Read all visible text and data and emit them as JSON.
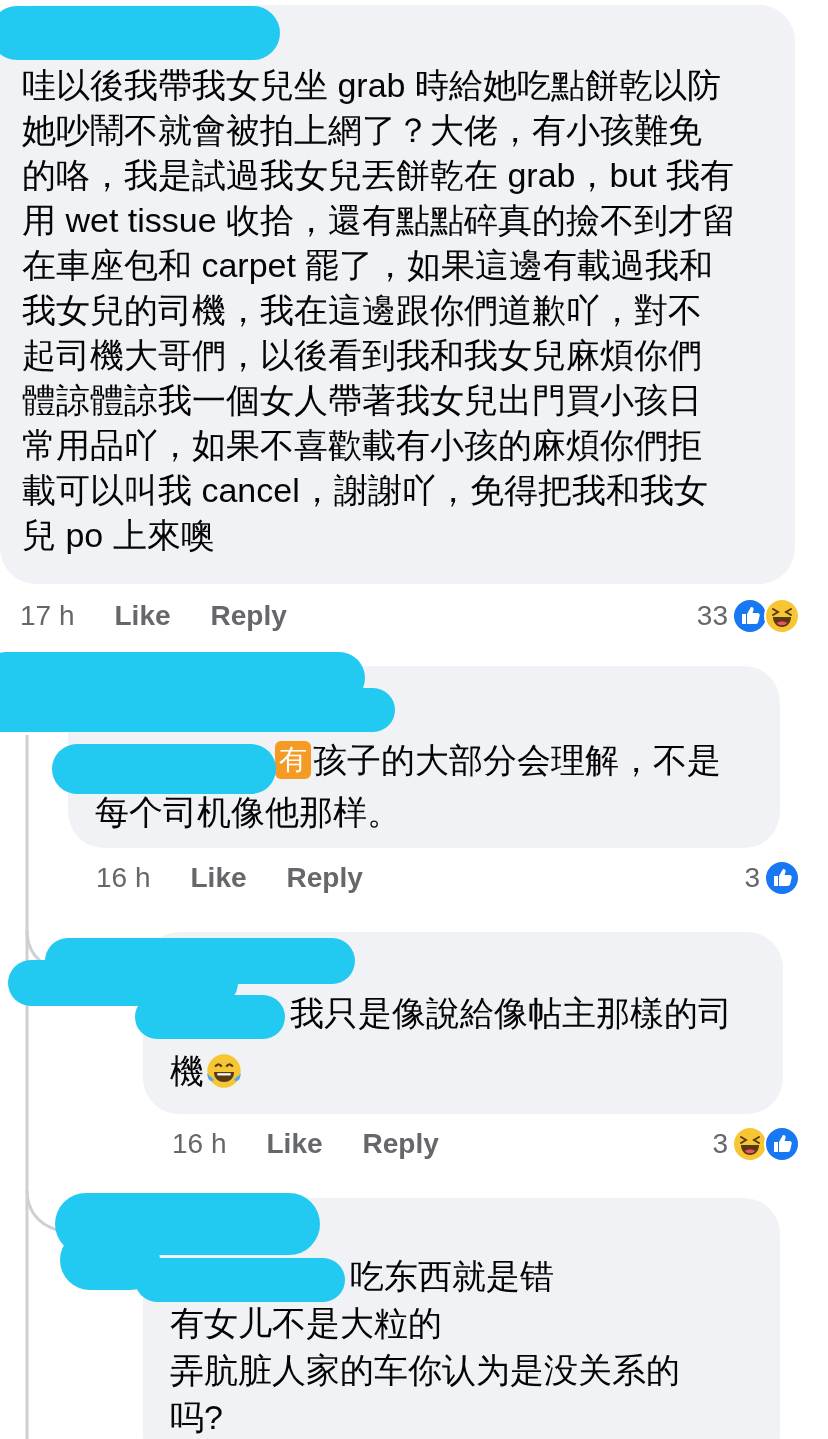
{
  "comments": [
    {
      "lines": [
        "哇以後我帶我女兒坐 grab 時給她吃點餅乾以防",
        "她吵鬧不就會被拍上網了？大佬，有小孩難免",
        "的咯，我是試過我女兒丟餅乾在 grab，but 我有",
        "用 wet tissue 收拾，還有點點碎真的撿不到才留",
        "在車座包和 carpet 罷了，如果這邊有載過我和",
        "我女兒的司機，我在這邊跟你們道歉吖，對不",
        "起司機大哥們，以後看到我和我女兒麻煩你們",
        "體諒體諒我一個女人帶著我女兒出門買小孩日",
        "常用品吖，如果不喜歡載有小孩的麻煩你們拒",
        "載可以叫我 cancel，謝謝吖，免得把我和我女",
        "兒 po 上來噢"
      ],
      "time": "17 h",
      "like": "Like",
      "reply": "Reply",
      "reaction_count": "33",
      "reactions": [
        {
          "kind": "like"
        },
        {
          "kind": "haha"
        }
      ]
    },
    {
      "lead_badge": "有",
      "lines": [
        "孩子的大部分会理解，不是",
        "每个司机像他那样。"
      ],
      "time": "16 h",
      "like": "Like",
      "reply": "Reply",
      "reaction_count": "3",
      "reactions": [
        {
          "kind": "like"
        }
      ]
    },
    {
      "lines": [
        "我只是像說給像帖主那樣的司",
        "機"
      ],
      "trailing_icon": {
        "kind": "tears-of-joy"
      },
      "time": "16 h",
      "like": "Like",
      "reply": "Reply",
      "reaction_count": "3",
      "reactions": [
        {
          "kind": "haha"
        },
        {
          "kind": "like"
        }
      ]
    },
    {
      "lines": [
        "吃东西就是错",
        "有女儿不是大粒的",
        "弄肮脏人家的车你认为是没关系的",
        "吗?"
      ]
    }
  ]
}
